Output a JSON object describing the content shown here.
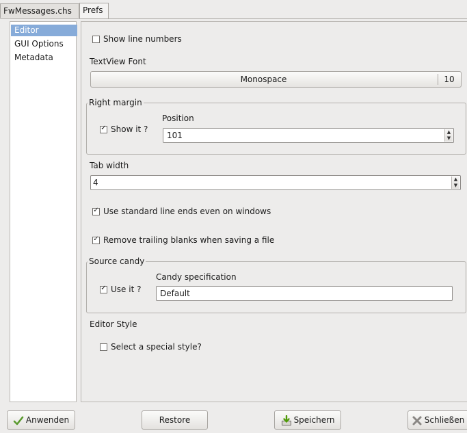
{
  "tabs": [
    {
      "label": "FwMessages.chs",
      "active": false
    },
    {
      "label": "Prefs",
      "active": true
    }
  ],
  "sidebar": {
    "items": [
      {
        "label": "Editor",
        "selected": true
      },
      {
        "label": "GUI Options",
        "selected": false
      },
      {
        "label": "Metadata",
        "selected": false
      }
    ]
  },
  "editor": {
    "show_line_numbers": {
      "label": "Show line numbers",
      "checked": false
    },
    "textview_font": {
      "label": "TextView Font",
      "font_name": "Monospace",
      "font_size": "10"
    },
    "right_margin": {
      "title": "Right margin",
      "show_it": {
        "label": "Show it ?",
        "checked": true
      },
      "position_label": "Position",
      "position_value": "101"
    },
    "tab_width": {
      "label": "Tab width",
      "value": "4"
    },
    "standard_line_ends": {
      "label": "Use standard line ends even on windows",
      "checked": true
    },
    "remove_trailing_blanks": {
      "label": "Remove trailing blanks when saving a file",
      "checked": true
    },
    "source_candy": {
      "title": "Source candy",
      "use_it": {
        "label": "Use it ?",
        "checked": true
      },
      "spec_label": "Candy specification",
      "spec_value": "Default"
    },
    "editor_style": {
      "label": "Editor Style",
      "special_style": {
        "label": "Select a special style?",
        "checked": false
      }
    }
  },
  "buttons": {
    "apply": "Anwenden",
    "restore": "Restore",
    "save": "Speichern",
    "close": "Schließen"
  },
  "colors": {
    "selection": "#86abd9",
    "background": "#edeceb"
  }
}
